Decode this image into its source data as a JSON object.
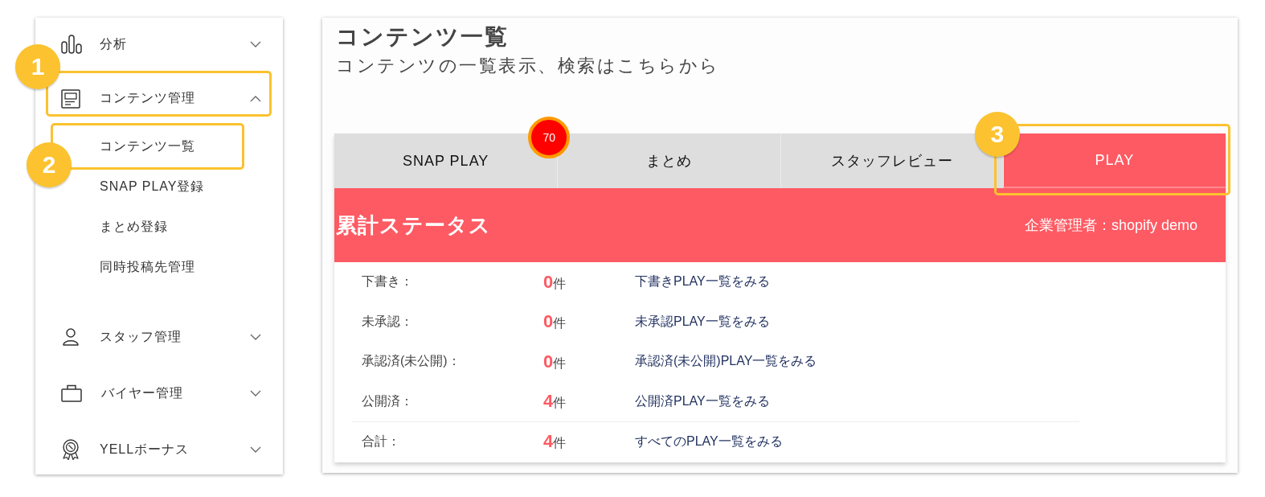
{
  "sidebar": {
    "items": [
      {
        "label": "分析",
        "expanded": false
      },
      {
        "label": "コンテンツ管理",
        "expanded": true,
        "callout": "1",
        "children": [
          {
            "label": "コンテンツ一覧",
            "callout": "2"
          },
          {
            "label": "SNAP PLAY登録"
          },
          {
            "label": "まとめ登録"
          },
          {
            "label": "同時投稿先管理"
          }
        ]
      },
      {
        "label": "スタッフ管理",
        "expanded": false
      },
      {
        "label": "バイヤー管理",
        "expanded": false
      },
      {
        "label": "YELLボーナス",
        "expanded": false
      }
    ]
  },
  "page": {
    "title": "コンテンツ一覧",
    "subtitle": "コンテンツの一覧表示、検索はこちらから"
  },
  "tabs": [
    {
      "label": "SNAP PLAY",
      "selected": false,
      "badge": "70"
    },
    {
      "label": "まとめ",
      "selected": false
    },
    {
      "label": "スタッフレビュー",
      "selected": false
    },
    {
      "label": "PLAY",
      "selected": true,
      "callout": "3"
    }
  ],
  "status_panel": {
    "title": "累計ステータス",
    "admin": "企業管理者：shopify demo",
    "rows": [
      {
        "kind": "status",
        "label": "下書き：",
        "count": "0",
        "unit": "件",
        "link": "下書きPLAY一覧をみる"
      },
      {
        "kind": "status",
        "label": "未承認：",
        "count": "0",
        "unit": "件",
        "link": "未承認PLAY一覧をみる"
      },
      {
        "kind": "status",
        "label": "承認済(未公開)：",
        "count": "0",
        "unit": "件",
        "link": "承認済(未公開)PLAY一覧をみる"
      },
      {
        "kind": "status",
        "label": "公開済：",
        "count": "4",
        "unit": "件",
        "link": "公開済PLAY一覧をみる"
      },
      {
        "kind": "total",
        "label": "合計：",
        "count": "4",
        "unit": "件",
        "link": "すべてのPLAY一覧をみる"
      }
    ]
  }
}
